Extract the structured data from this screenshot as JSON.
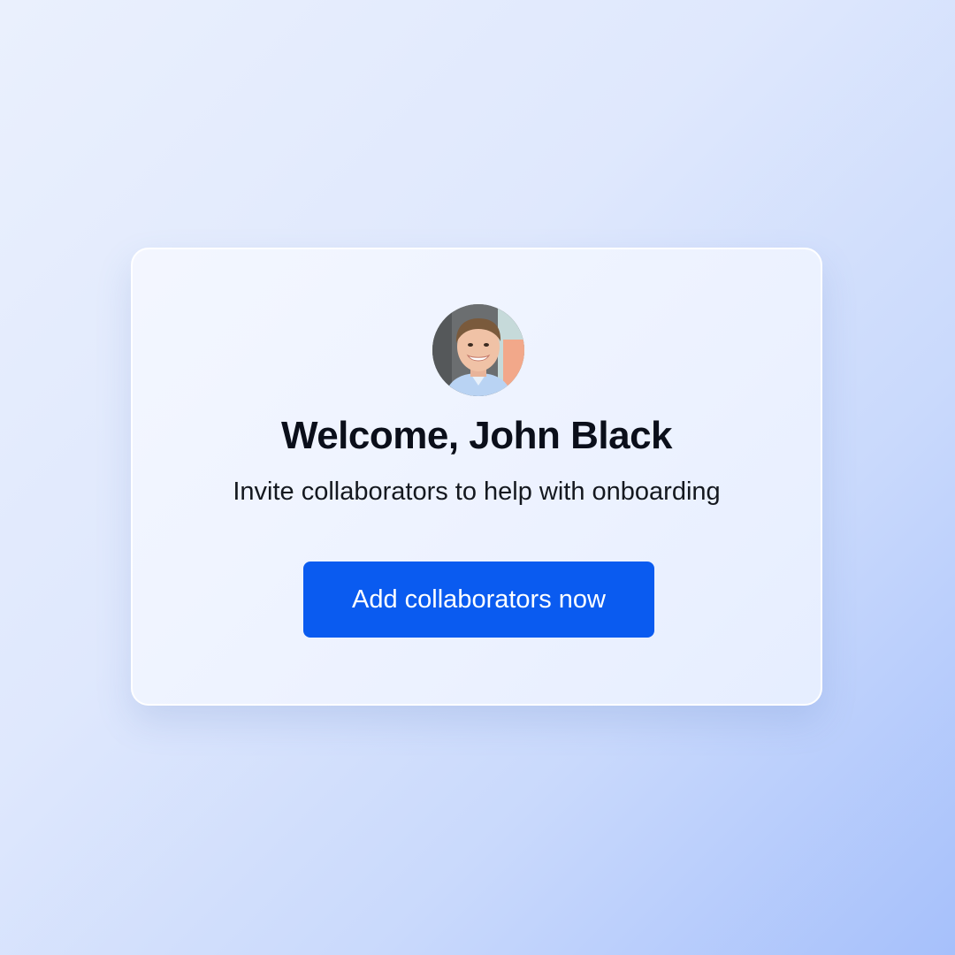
{
  "card": {
    "avatar_icon": "user-photo",
    "title": "Welcome, John Black",
    "subtitle": "Invite collaborators to help with onboarding",
    "cta_label": "Add collaborators now"
  },
  "colors": {
    "accent": "#0a5bf0",
    "title_text": "#0b0f1a",
    "card_bg": "#f0f4fe",
    "page_bg_start": "#eaf0fd",
    "page_bg_end": "#a6c0fb"
  }
}
